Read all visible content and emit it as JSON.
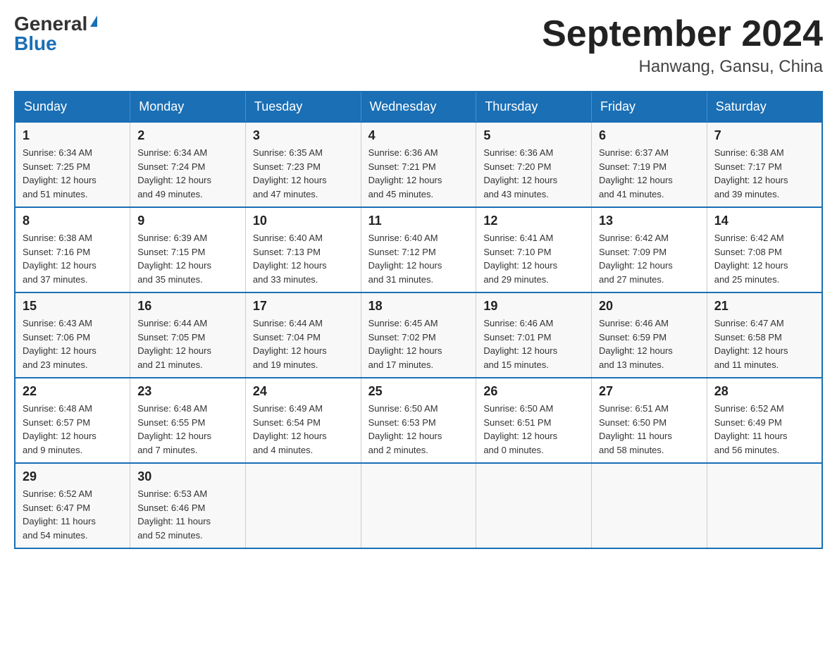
{
  "header": {
    "logo": {
      "general": "General",
      "blue": "Blue"
    },
    "title": "September 2024",
    "location": "Hanwang, Gansu, China"
  },
  "days_of_week": [
    "Sunday",
    "Monday",
    "Tuesday",
    "Wednesday",
    "Thursday",
    "Friday",
    "Saturday"
  ],
  "weeks": [
    [
      {
        "day": "1",
        "sunrise": "6:34 AM",
        "sunset": "7:25 PM",
        "daylight": "12 hours and 51 minutes."
      },
      {
        "day": "2",
        "sunrise": "6:34 AM",
        "sunset": "7:24 PM",
        "daylight": "12 hours and 49 minutes."
      },
      {
        "day": "3",
        "sunrise": "6:35 AM",
        "sunset": "7:23 PM",
        "daylight": "12 hours and 47 minutes."
      },
      {
        "day": "4",
        "sunrise": "6:36 AM",
        "sunset": "7:21 PM",
        "daylight": "12 hours and 45 minutes."
      },
      {
        "day": "5",
        "sunrise": "6:36 AM",
        "sunset": "7:20 PM",
        "daylight": "12 hours and 43 minutes."
      },
      {
        "day": "6",
        "sunrise": "6:37 AM",
        "sunset": "7:19 PM",
        "daylight": "12 hours and 41 minutes."
      },
      {
        "day": "7",
        "sunrise": "6:38 AM",
        "sunset": "7:17 PM",
        "daylight": "12 hours and 39 minutes."
      }
    ],
    [
      {
        "day": "8",
        "sunrise": "6:38 AM",
        "sunset": "7:16 PM",
        "daylight": "12 hours and 37 minutes."
      },
      {
        "day": "9",
        "sunrise": "6:39 AM",
        "sunset": "7:15 PM",
        "daylight": "12 hours and 35 minutes."
      },
      {
        "day": "10",
        "sunrise": "6:40 AM",
        "sunset": "7:13 PM",
        "daylight": "12 hours and 33 minutes."
      },
      {
        "day": "11",
        "sunrise": "6:40 AM",
        "sunset": "7:12 PM",
        "daylight": "12 hours and 31 minutes."
      },
      {
        "day": "12",
        "sunrise": "6:41 AM",
        "sunset": "7:10 PM",
        "daylight": "12 hours and 29 minutes."
      },
      {
        "day": "13",
        "sunrise": "6:42 AM",
        "sunset": "7:09 PM",
        "daylight": "12 hours and 27 minutes."
      },
      {
        "day": "14",
        "sunrise": "6:42 AM",
        "sunset": "7:08 PM",
        "daylight": "12 hours and 25 minutes."
      }
    ],
    [
      {
        "day": "15",
        "sunrise": "6:43 AM",
        "sunset": "7:06 PM",
        "daylight": "12 hours and 23 minutes."
      },
      {
        "day": "16",
        "sunrise": "6:44 AM",
        "sunset": "7:05 PM",
        "daylight": "12 hours and 21 minutes."
      },
      {
        "day": "17",
        "sunrise": "6:44 AM",
        "sunset": "7:04 PM",
        "daylight": "12 hours and 19 minutes."
      },
      {
        "day": "18",
        "sunrise": "6:45 AM",
        "sunset": "7:02 PM",
        "daylight": "12 hours and 17 minutes."
      },
      {
        "day": "19",
        "sunrise": "6:46 AM",
        "sunset": "7:01 PM",
        "daylight": "12 hours and 15 minutes."
      },
      {
        "day": "20",
        "sunrise": "6:46 AM",
        "sunset": "6:59 PM",
        "daylight": "12 hours and 13 minutes."
      },
      {
        "day": "21",
        "sunrise": "6:47 AM",
        "sunset": "6:58 PM",
        "daylight": "12 hours and 11 minutes."
      }
    ],
    [
      {
        "day": "22",
        "sunrise": "6:48 AM",
        "sunset": "6:57 PM",
        "daylight": "12 hours and 9 minutes."
      },
      {
        "day": "23",
        "sunrise": "6:48 AM",
        "sunset": "6:55 PM",
        "daylight": "12 hours and 7 minutes."
      },
      {
        "day": "24",
        "sunrise": "6:49 AM",
        "sunset": "6:54 PM",
        "daylight": "12 hours and 4 minutes."
      },
      {
        "day": "25",
        "sunrise": "6:50 AM",
        "sunset": "6:53 PM",
        "daylight": "12 hours and 2 minutes."
      },
      {
        "day": "26",
        "sunrise": "6:50 AM",
        "sunset": "6:51 PM",
        "daylight": "12 hours and 0 minutes."
      },
      {
        "day": "27",
        "sunrise": "6:51 AM",
        "sunset": "6:50 PM",
        "daylight": "11 hours and 58 minutes."
      },
      {
        "day": "28",
        "sunrise": "6:52 AM",
        "sunset": "6:49 PM",
        "daylight": "11 hours and 56 minutes."
      }
    ],
    [
      {
        "day": "29",
        "sunrise": "6:52 AM",
        "sunset": "6:47 PM",
        "daylight": "11 hours and 54 minutes."
      },
      {
        "day": "30",
        "sunrise": "6:53 AM",
        "sunset": "6:46 PM",
        "daylight": "11 hours and 52 minutes."
      },
      null,
      null,
      null,
      null,
      null
    ]
  ],
  "labels": {
    "sunrise": "Sunrise:",
    "sunset": "Sunset:",
    "daylight": "Daylight:"
  }
}
